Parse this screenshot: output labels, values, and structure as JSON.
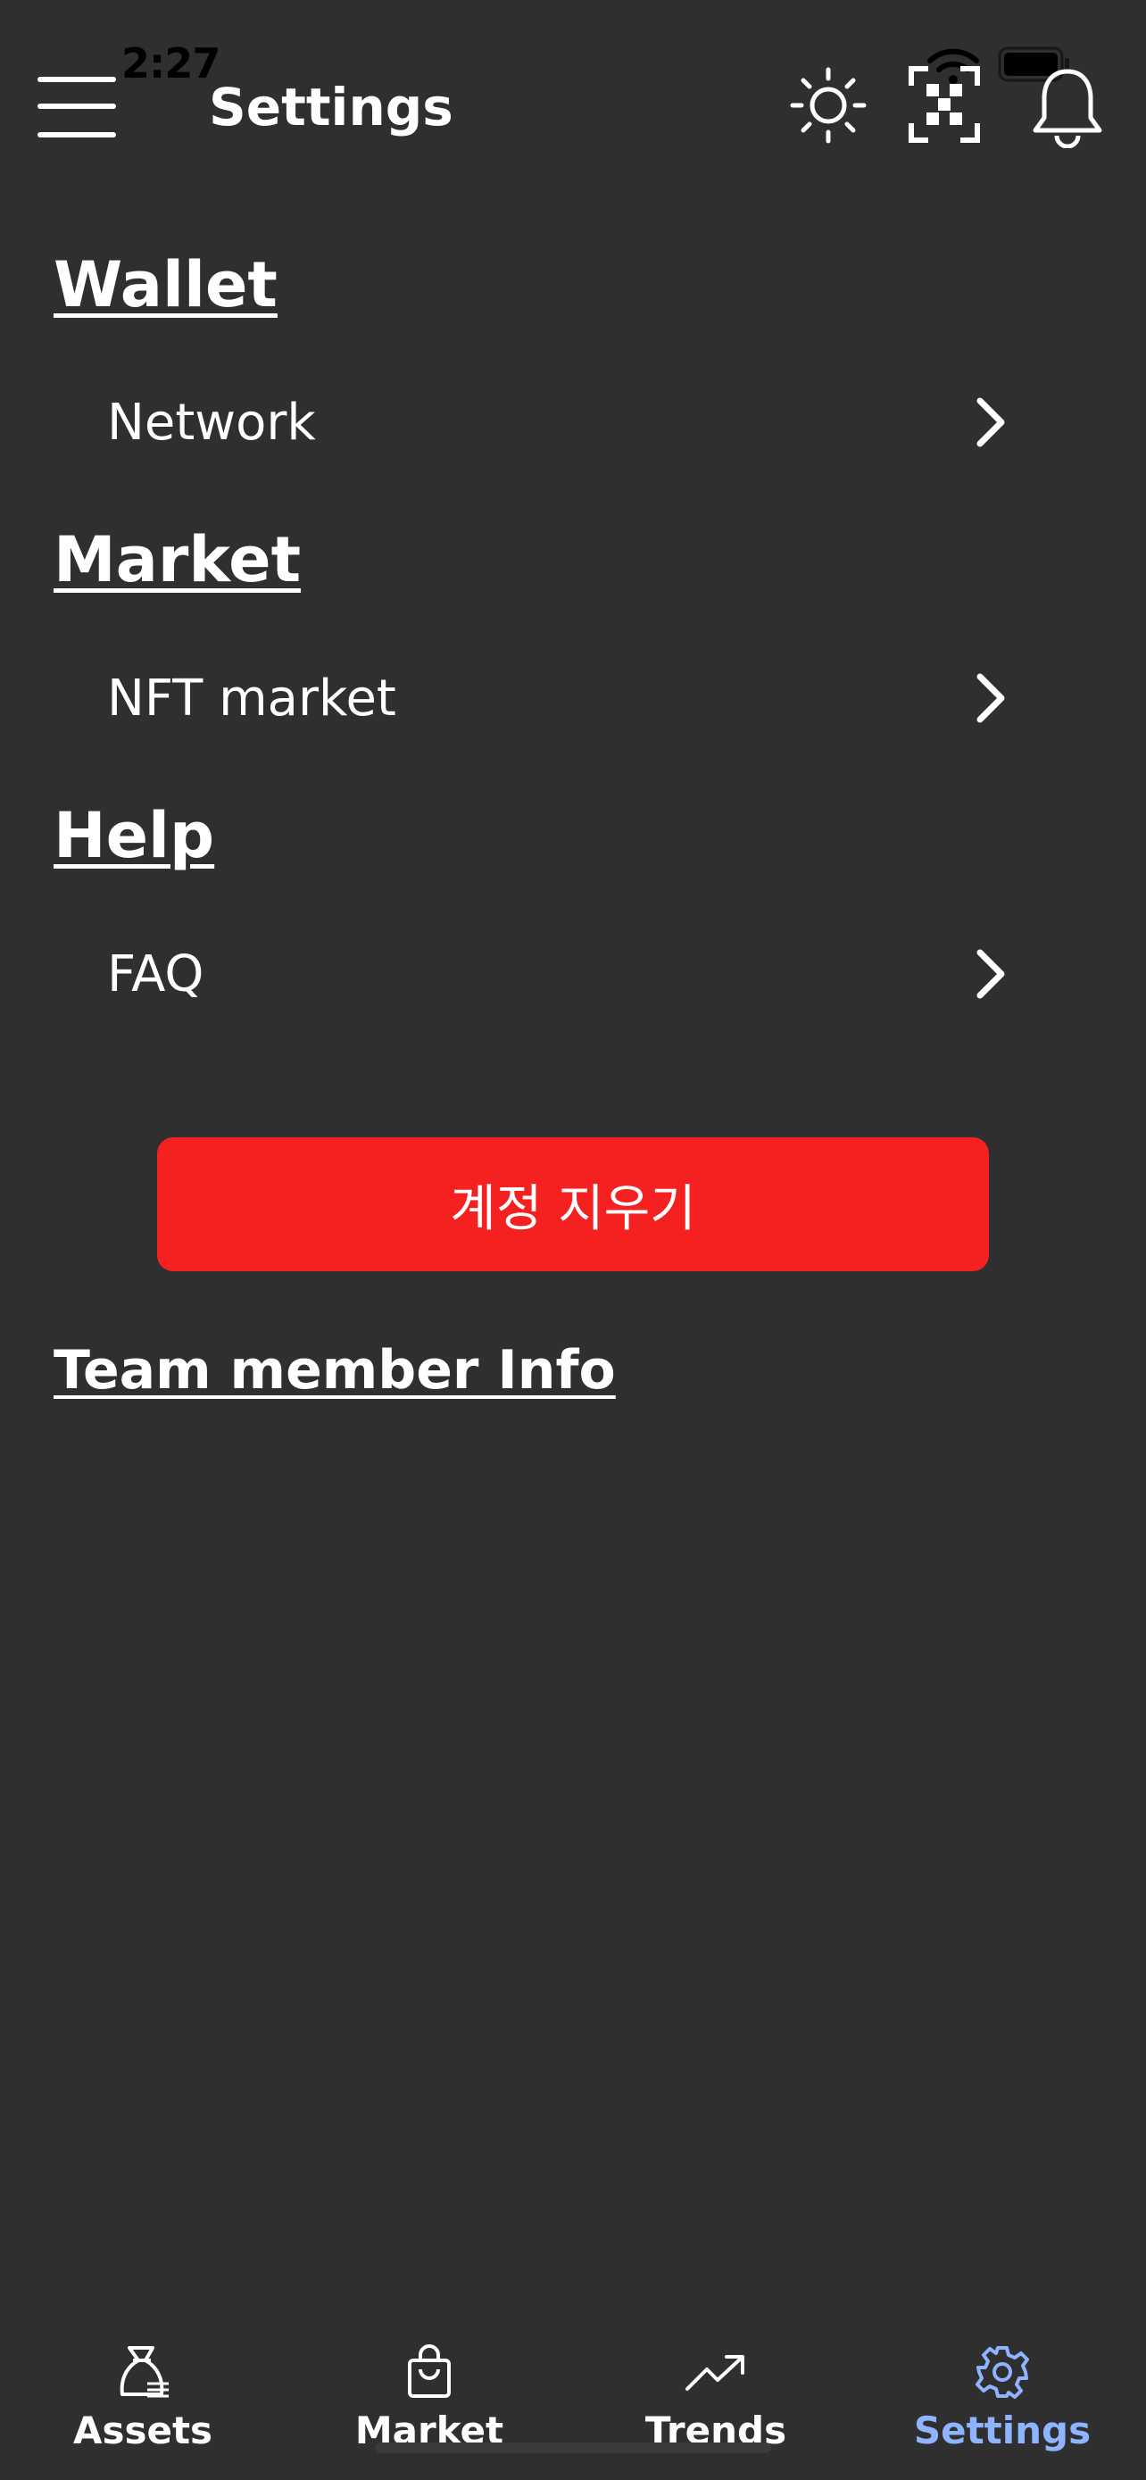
{
  "status_bar": {
    "time": "2:27"
  },
  "header": {
    "title": "Settings",
    "icons": [
      "menu-icon",
      "sun-icon",
      "qr-scan-icon",
      "bell-icon"
    ]
  },
  "sections": {
    "wallet": {
      "heading": "Wallet",
      "item": "Network"
    },
    "market": {
      "heading": "Market",
      "item": "NFT market"
    },
    "help": {
      "heading": "Help",
      "item": "FAQ"
    }
  },
  "delete_account_button": "계정 지우기",
  "team_member_link": "Team member Info",
  "tabs": {
    "assets": "Assets",
    "market": "Market",
    "trends": "Trends",
    "settings": "Settings"
  },
  "colors": {
    "background": "#2f2f30",
    "delete_button": "#f52020",
    "active_tab": "#8fb4ff"
  },
  "active_tab": "settings"
}
